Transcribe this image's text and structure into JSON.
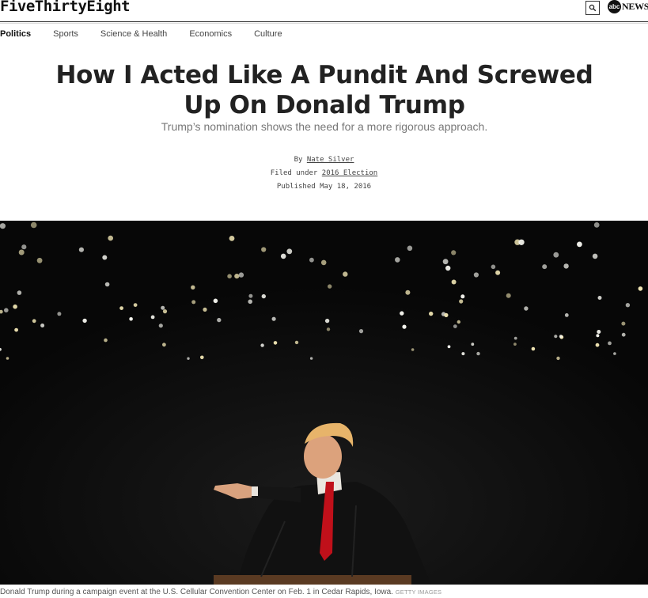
{
  "header": {
    "logo": "FiveThirtyEight",
    "partner_logo_circle": "abc",
    "partner_logo_text": "NEWS",
    "search_icon": "search-icon"
  },
  "nav": {
    "items": [
      "Politics",
      "Sports",
      "Science & Health",
      "Economics",
      "Culture"
    ],
    "active": "Politics"
  },
  "article": {
    "headline_line1": "How I Acted Like A Pundit And Screwed",
    "headline_line2": "Up On Donald Trump",
    "dek": "Trump’s nomination shows the need for a more rigorous approach.",
    "byline_prefix": "By",
    "author": "Nate Silver",
    "filed_prefix": "Filed under",
    "filed_under": "2016 Election",
    "published": "Published May 18, 2016"
  },
  "hero": {
    "caption": "Donald Trump during a campaign event at the U.S. Cellular Convention Center on Feb. 1 in Cedar Rapids, Iowa.",
    "credit": "GETTY IMAGES"
  },
  "colors": {
    "background": "#ffffff",
    "text": "#222222",
    "dek": "#777777",
    "hero_bg": "#0b0b0b"
  }
}
